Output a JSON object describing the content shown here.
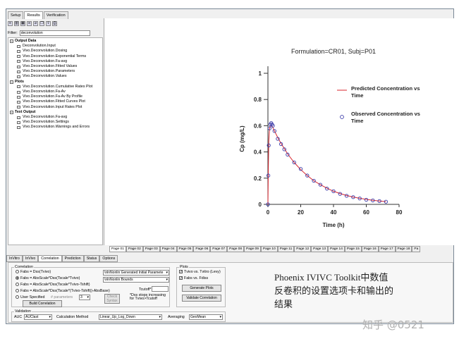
{
  "top_tabs": [
    "Setup",
    "Results",
    "Verification"
  ],
  "filter": {
    "label": "Filter:",
    "value": "deconvolution"
  },
  "tree": {
    "output_data": {
      "label": "Output Data",
      "items": [
        "Deconvolution.Input",
        "Vivo.Deconvolution.Dosing",
        "Vivo.Deconvolution.Exponential Terms",
        "Vivo.Deconvolution.Fa-avg",
        "Vivo.Deconvolution.Fitted Values",
        "Vivo.Deconvolution.Parameters",
        "Vivo.Deconvolution.Values"
      ]
    },
    "plots": {
      "label": "Plots",
      "items": [
        "Vivo.Deconvolution.Cumulative Rates Plot",
        "Vivo.Deconvolution.Fa-Av",
        "Vivo.Deconvolution.Fa-Av By Profile",
        "Vivo.Deconvolution.Fitted Curves Plot",
        "Vivo.Deconvolution.Input Rates Plot"
      ]
    },
    "text_output": {
      "label": "Text Output",
      "items": [
        "Vivo.Deconvolution.Fa-avg",
        "Vivo.Deconvolution.Settings",
        "Vivo.Deconvolution.Warnings and Errors"
      ]
    }
  },
  "chart_data": {
    "type": "line",
    "title": "Formulation=CR01, Subj=P01",
    "xlabel": "Time (h)",
    "ylabel": "Cp (mg/L)",
    "xlim": [
      0,
      80
    ],
    "ylim": [
      0,
      1
    ],
    "xticks": [
      "0",
      "20",
      "40",
      "60",
      "80"
    ],
    "yticks": [
      "0",
      "0.2",
      "0.4",
      "0.6",
      "0.8",
      "1"
    ],
    "grid": false,
    "legend_position": "top-right",
    "series": [
      {
        "name": "Predicted Concentration vs Time",
        "kind": "line",
        "color": "#d9262e",
        "x": [
          0,
          0.25,
          0.5,
          1,
          1.5,
          2,
          2.5,
          3,
          4,
          6,
          8,
          10,
          12,
          16,
          20,
          24,
          28,
          32,
          36,
          40,
          44,
          48,
          52,
          56,
          60,
          64,
          68,
          72
        ],
        "y": [
          0,
          0.28,
          0.48,
          0.58,
          0.6,
          0.6,
          0.595,
          0.585,
          0.56,
          0.51,
          0.465,
          0.425,
          0.385,
          0.32,
          0.265,
          0.22,
          0.18,
          0.15,
          0.123,
          0.1,
          0.083,
          0.068,
          0.056,
          0.046,
          0.038,
          0.031,
          0.026,
          0.021
        ]
      },
      {
        "name": "Observed Concentration vs Time",
        "kind": "scatter",
        "color": "#3a3aa8",
        "x": [
          0,
          0.25,
          0.5,
          1,
          1.5,
          2,
          2.5,
          3,
          4,
          6,
          8,
          10,
          12,
          16,
          20,
          24,
          28,
          32,
          36,
          40,
          44,
          48,
          52,
          56,
          60,
          64,
          68,
          72
        ],
        "y": [
          0,
          0.22,
          0.45,
          0.58,
          0.61,
          0.62,
          0.61,
          0.6,
          0.56,
          0.5,
          0.46,
          0.42,
          0.38,
          0.32,
          0.27,
          0.22,
          0.18,
          0.15,
          0.12,
          0.1,
          0.08,
          0.065,
          0.055,
          0.045,
          0.035,
          0.03,
          0.025,
          0.02
        ]
      }
    ]
  },
  "page_tabs": [
    "Page 01",
    "Page 02",
    "Page 03",
    "Page 04",
    "Page 05",
    "Page 06",
    "Page 07",
    "Page 08",
    "Page 09",
    "Page 10",
    "Page 11",
    "Page 12",
    "Page 13",
    "Page 14",
    "Page 15",
    "Page 16",
    "Page 17",
    "Page 18",
    "Pa"
  ],
  "bottom_tabs": [
    "InVitro",
    "InVivo",
    "Correlation",
    "Prediction",
    "Status",
    "Options"
  ],
  "correlation": {
    "group_label": "Correlation",
    "options": [
      "Fabs = Dss(Tvivo)",
      "Fabs = AbsScale*Dss(Tscale*Tvivo)",
      "Fabs = AbsScale*Dss(Tscale*Tvivo-Tshift)",
      "Fabs = AbsScale*Dss(Tscale*(Tvivo-Tshift))-AbsBase)",
      "User Specified"
    ],
    "params_label": "# parameters",
    "params_value": "3",
    "check_syntax": "Check Syntax",
    "select1": "\\nlnNonlin Generated Initial Paramete",
    "select2": "\\nlnNonlin Bounds",
    "tcutoff_label": "Tcutoff*",
    "note": "*Dss stops increasing for Tvivo>Tcutoff",
    "build_button": "Build Correlation"
  },
  "plots_group": {
    "label": "Plots",
    "options": [
      "Tvivo vs. Tvitro (Levy)",
      "Fabs vs. Fdiss"
    ],
    "generate_button": "Generate Plots",
    "validate_button": "Validate Correlation"
  },
  "validation": {
    "label": "Validation",
    "auc_label": "AUC",
    "auc_value": "AUClast",
    "calc_label": "Calculation Method",
    "calc_value": "Linear_Up_Log_Down",
    "avg_label": "Averaging",
    "avg_value": "GeoMean"
  },
  "caption": {
    "line1": "Phoenix IVIVC Toolkit中数值",
    "line2": "反卷积的设置选项卡和输出的",
    "line3": "结果"
  },
  "watermark": "知乎 @0521"
}
